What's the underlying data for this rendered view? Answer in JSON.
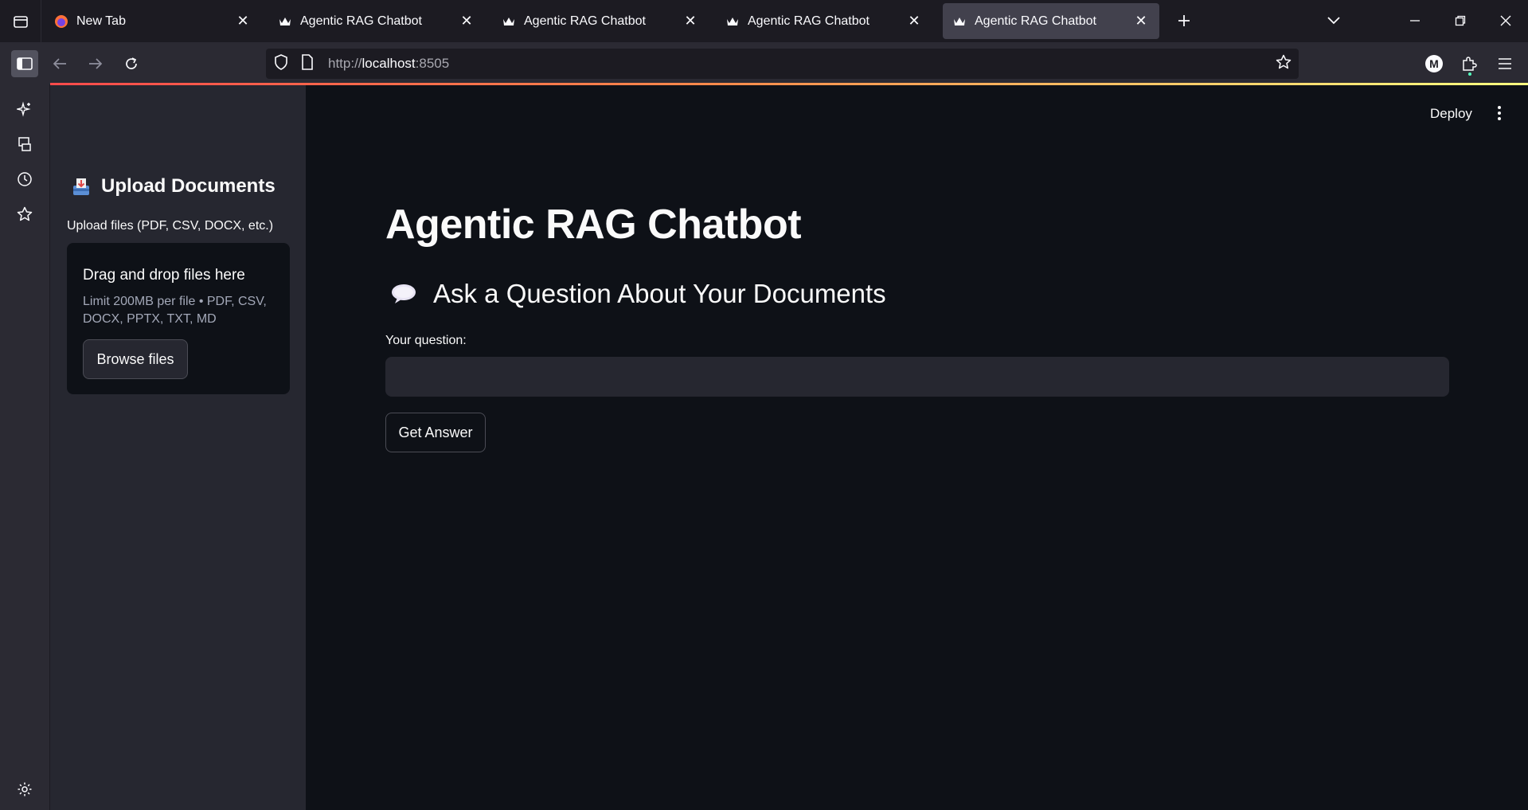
{
  "browser": {
    "tabs": [
      {
        "title": "New Tab",
        "favicon": "firefox-icon"
      },
      {
        "title": "Agentic RAG Chatbot",
        "favicon": "crown-icon"
      },
      {
        "title": "Agentic RAG Chatbot",
        "favicon": "crown-icon"
      },
      {
        "title": "Agentic RAG Chatbot",
        "favicon": "crown-icon"
      },
      {
        "title": "Agentic RAG Chatbot",
        "favicon": "crown-icon",
        "active": true
      }
    ],
    "url": {
      "scheme": "http://",
      "host": "localhost",
      "port": ":8505"
    },
    "profile_initial": "M"
  },
  "sidebar": {
    "title": "Upload Documents",
    "upload_label": "Upload files (PDF, CSV, DOCX, etc.)",
    "dropzone_title": "Drag and drop files here",
    "dropzone_limit": "Limit 200MB per file • PDF, CSV, DOCX, PPTX, TXT, MD",
    "browse_label": "Browse files"
  },
  "main": {
    "deploy_label": "Deploy",
    "title": "Agentic RAG Chatbot",
    "subtitle": "Ask a Question About Your Documents",
    "question_label": "Your question:",
    "question_value": "",
    "button_label": "Get Answer"
  },
  "colors": {
    "background": "#0e1117",
    "sidebar": "#262730",
    "accent_gradient": [
      "#ff4b4b",
      "#fffd80"
    ]
  }
}
